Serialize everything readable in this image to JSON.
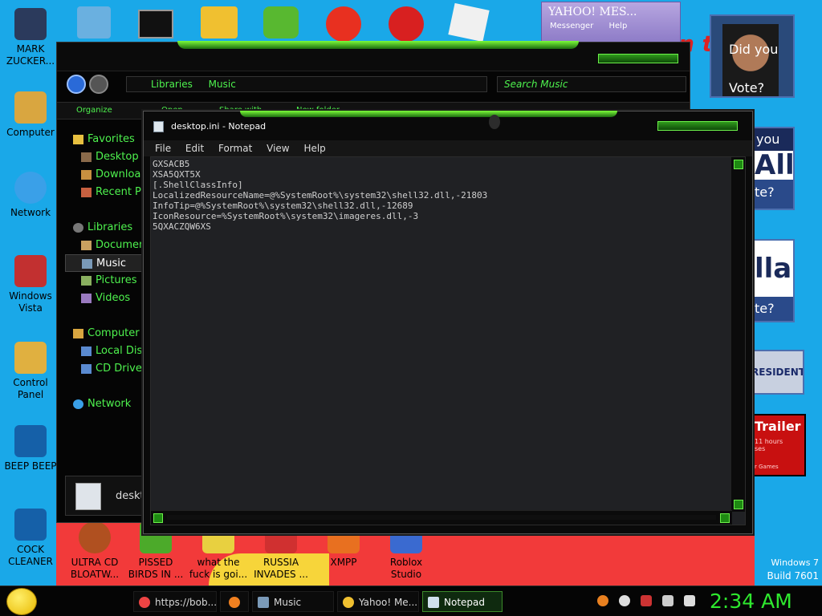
{
  "desktop_icons": [
    {
      "label": "MARK ZUCKER...",
      "color": "#2b3a5c"
    },
    {
      "label": "Computer",
      "color": "#d9a640"
    },
    {
      "label": "Network",
      "color": "#3aa0e8"
    },
    {
      "label": "Windows Vista",
      "color": "#c23030"
    },
    {
      "label": "Control Panel",
      "color": "#e0b040"
    },
    {
      "label": "BEEP BEEP",
      "color": "#1560a8"
    },
    {
      "label": "COCK CLEANER",
      "color": "#1560a8"
    },
    {
      "label": "ULTRA CD BLOATW...",
      "color": "#b05020"
    },
    {
      "label": "PISSED BIRDS IN ...",
      "color": "#4caa2a"
    },
    {
      "label": "what the fuck is goi...",
      "color": "#e8d040"
    },
    {
      "label": "RUSSIA INVADES ...",
      "color": "#d03030"
    },
    {
      "label": "XMPP",
      "color": "#e87020"
    },
    {
      "label": "Roblox Studio",
      "color": "#3a6ad0"
    }
  ],
  "explorer": {
    "breadcrumb": [
      "Libraries",
      "Music"
    ],
    "search_placeholder": "Search Music",
    "commands": [
      "Organize",
      "Open",
      "Share with",
      "New folder"
    ],
    "sidebar": {
      "favorites": "Favorites",
      "favorites_items": [
        "Desktop",
        "Downloads",
        "Recent Places"
      ],
      "libraries": "Libraries",
      "libraries_items": [
        "Documents",
        "Music",
        "Pictures",
        "Videos"
      ],
      "computer": "Computer",
      "computer_items": [
        "Local Disk",
        "CD Drive"
      ],
      "network": "Network"
    },
    "details_label": "deskt"
  },
  "notepad": {
    "title": "desktop.ini - Notepad",
    "menu": [
      "File",
      "Edit",
      "Format",
      "View",
      "Help"
    ],
    "content": "GXSACB5\nXSA5QXT5X\n[.ShellClassInfo]\nLocalizedResourceName=@%SystemRoot%\\system32\\shell32.dll,-21803\nInfoTip=@%SystemRoot%\\system32\\shell32.dll,-12689\nIconResource=%SystemRoot%\\system32\\imageres.dll,-3\n5QXACZQW6XS"
  },
  "yahoo_popup": {
    "title": "YAHOO! MES...",
    "subtitle": "Messenger",
    "help": "Help"
  },
  "ads": {
    "obama_text": "Did you Vote?",
    "you_text": "you",
    "all_text": "All",
    "te1": "te?",
    "lla": "lla",
    "te2": "te?",
    "president": "RESIDENT",
    "trailer": "Trailer",
    "hours": "11 hours",
    "ses": "ses",
    "games": "r Games",
    "red_letter": "n t"
  },
  "taskbar": {
    "items": [
      {
        "label": "https://bob...",
        "icon_color": "#e44"
      },
      {
        "label": "",
        "icon_color": "#f08020"
      },
      {
        "label": "Music",
        "icon_color": "#7a9ab8"
      },
      {
        "label": "Yahoo! Me...",
        "icon_color": "#f0c030"
      },
      {
        "label": "Notepad",
        "icon_color": "#cfe0ee"
      }
    ],
    "clock": "2:34 AM"
  },
  "windows_version": {
    "line1": "Windows 7",
    "line2": "Build 7601"
  }
}
